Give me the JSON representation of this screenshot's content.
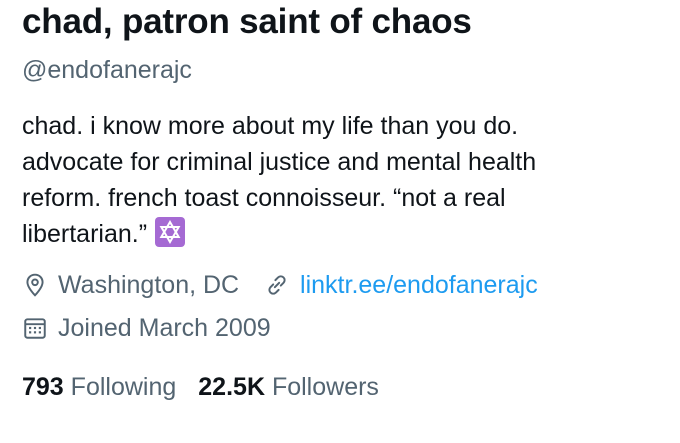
{
  "profile": {
    "display_name": "chad, patron saint of chaos",
    "handle": "@endofanerajc",
    "bio_lines": [
      "chad. i know more about my life than you do.",
      "advocate for criminal justice and mental health",
      "reform. french toast connoisseur. “not a real",
      "libertarian.”"
    ],
    "bio_emoji": "star-of-david-icon",
    "location": "Washington, DC",
    "website": "linktr.ee/endofanerajc",
    "joined": "Joined March 2009",
    "following_count": "793",
    "following_label": "Following",
    "followers_count": "22.5K",
    "followers_label": "Followers"
  },
  "colors": {
    "text_primary": "#0f1419",
    "text_secondary": "#536471",
    "link": "#1d9bf0",
    "emoji_badge": "#a56ad3"
  }
}
